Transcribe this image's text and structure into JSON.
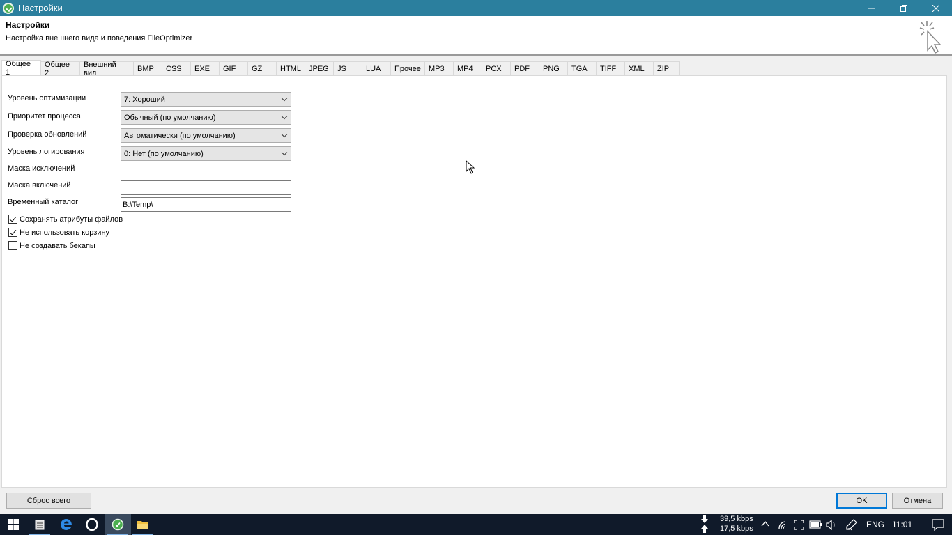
{
  "window": {
    "title": "Настройки"
  },
  "header": {
    "title": "Настройки",
    "subtitle": "Настройка внешнего вида и поведения FileOptimizer"
  },
  "tabs": [
    "Общее 1",
    "Общее 2",
    "Внешний вид",
    "BMP",
    "CSS",
    "EXE",
    "GIF",
    "GZ",
    "HTML",
    "JPEG",
    "JS",
    "LUA",
    "Прочее",
    "MP3",
    "MP4",
    "PCX",
    "PDF",
    "PNG",
    "TGA",
    "TIFF",
    "XML",
    "ZIP"
  ],
  "active_tab": "Общее 1",
  "general": {
    "optimization_level": {
      "label": "Уровень оптимизации",
      "value": "7: Хороший"
    },
    "process_priority": {
      "label": "Приоритет процесса",
      "value": "Обычный (по умолчанию)"
    },
    "update_check": {
      "label": "Проверка обновлений",
      "value": "Автоматически (по умолчанию)"
    },
    "log_level": {
      "label": "Уровень логирования",
      "value": "0: Нет (по умолчанию)"
    },
    "exclude_mask": {
      "label": "Маска исключений",
      "value": ""
    },
    "include_mask": {
      "label": "Маска включений",
      "value": ""
    },
    "temp_dir": {
      "label": "Временный каталог",
      "value": "B:\\Temp\\"
    },
    "keep_attributes": {
      "label": "Сохранять атрибуты файлов",
      "checked": true
    },
    "no_recycle_bin": {
      "label": "Не использовать корзину",
      "checked": true
    },
    "no_backups": {
      "label": "Не создавать бекапы",
      "checked": false
    }
  },
  "buttons": {
    "reset_all": "Сброс всего",
    "ok": "OK",
    "cancel": "Отмена"
  },
  "taskbar": {
    "net_down": "39,5 kbps",
    "net_up": "17,5 kbps",
    "language": "ENG",
    "time": "11:01"
  }
}
